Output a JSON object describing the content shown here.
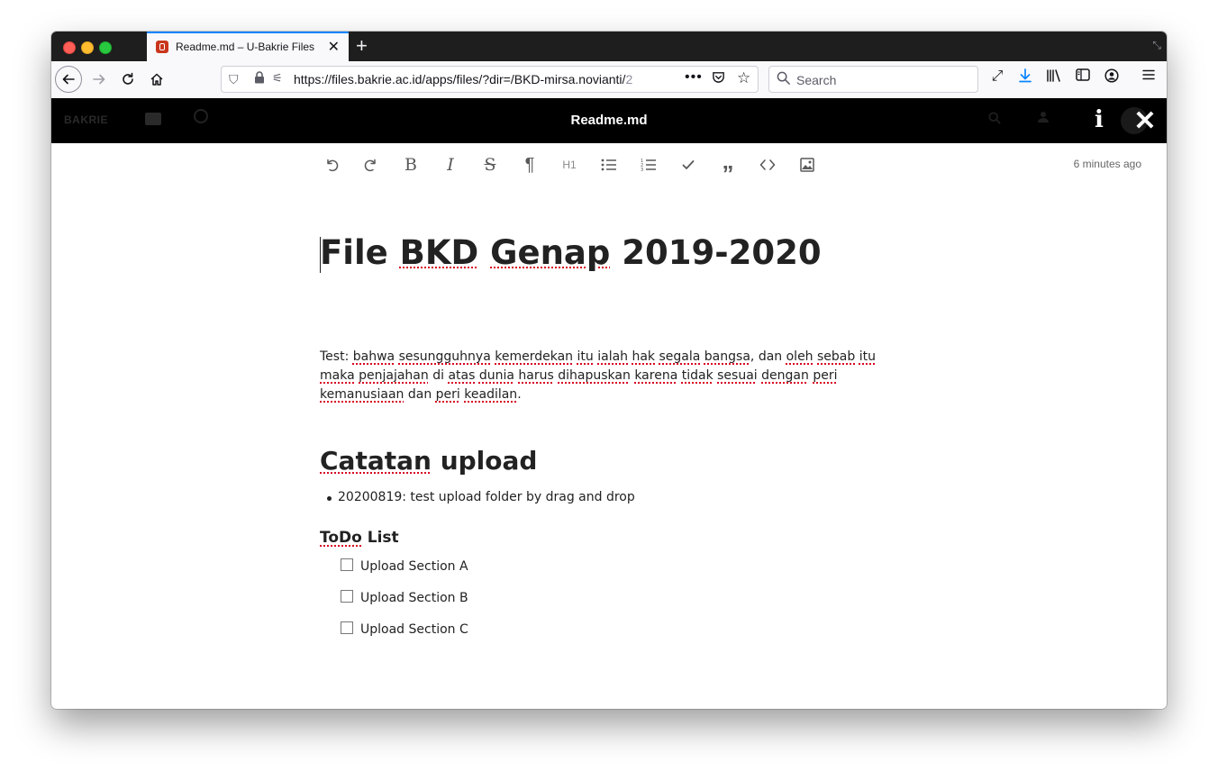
{
  "browser": {
    "tab_title": "Readme.md – U-Bakrie Files",
    "url_main": "https://files.bakrie.ac.id/apps/files/?dir=/BKD-mirsa.novianti/",
    "url_tail": "2",
    "search_placeholder": "Search"
  },
  "app": {
    "logo_text": "BAKRIE",
    "viewer_title": "Readme.md"
  },
  "toolbar": {
    "h1_label": "H1",
    "last_saved": "6 minutes ago"
  },
  "document": {
    "title": {
      "words": [
        "File",
        "BKD",
        "Genap",
        "2019-2020"
      ],
      "misspelled": [
        false,
        true,
        true,
        false
      ]
    },
    "paragraph": "Test: bahwa sesungguhnya kemerdekan itu ialah hak segala bangsa, dan oleh sebab itu maka penjajahan di atas dunia harus dihapuskan karena tidak sesuai dengan peri kemanusiaan dan peri keadilan.",
    "section_heading": {
      "word1": "Catatan",
      "word2": "upload"
    },
    "bullets": [
      "20200819: test upload folder by drag and drop"
    ],
    "todo_heading": {
      "word1": "ToDo",
      "word2": "List"
    },
    "todos": [
      {
        "label": "Upload Section A",
        "checked": false
      },
      {
        "label": "Upload Section B",
        "checked": false
      },
      {
        "label": "Upload Section C",
        "checked": false
      }
    ]
  }
}
